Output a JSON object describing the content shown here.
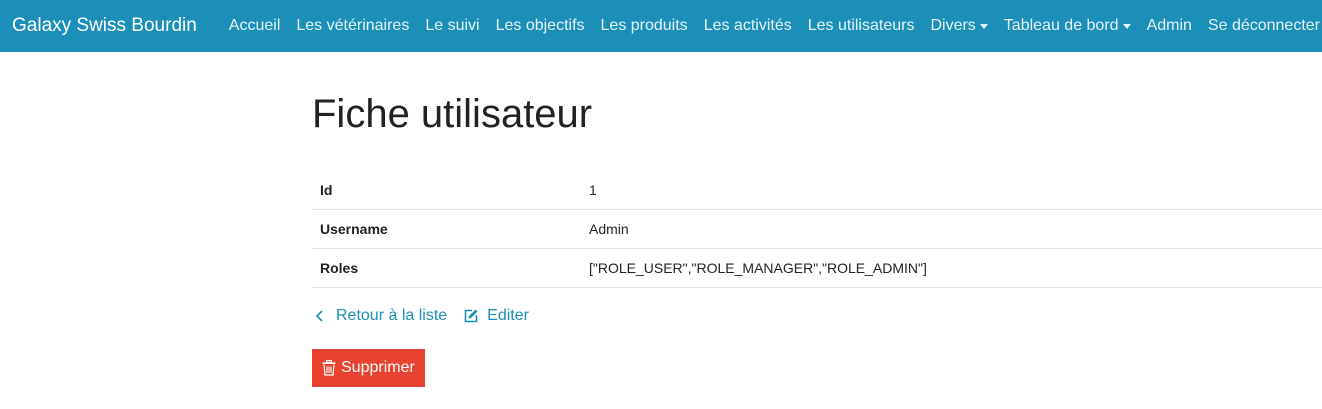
{
  "navbar": {
    "brand": "Galaxy Swiss Bourdin",
    "items": [
      {
        "label": "Accueil"
      },
      {
        "label": "Les vétérinaires"
      },
      {
        "label": "Le suivi"
      },
      {
        "label": "Les objectifs"
      },
      {
        "label": "Les produits"
      },
      {
        "label": "Les activités"
      },
      {
        "label": "Les utilisateurs"
      },
      {
        "label": "Divers",
        "dropdown": true
      },
      {
        "label": "Tableau de bord",
        "dropdown": true
      },
      {
        "label": "Admin"
      },
      {
        "label": "Se déconnecter"
      }
    ],
    "background_color": "#1b8fb7"
  },
  "page": {
    "title": "Fiche utilisateur"
  },
  "details": {
    "rows": [
      {
        "key": "Id",
        "value": "1"
      },
      {
        "key": "Username",
        "value": "Admin"
      },
      {
        "key": "Roles",
        "value": "[\"ROLE_USER\",\"ROLE_MANAGER\",\"ROLE_ADMIN\"]"
      }
    ]
  },
  "actions": {
    "back_label": "Retour à la liste",
    "back_icon": "chevron-left-icon",
    "edit_label": "Editer",
    "edit_icon": "edit-icon",
    "link_color": "#1b8fb7"
  },
  "delete": {
    "label": "Supprimer",
    "icon": "trash-icon",
    "color": "#e8432e"
  }
}
